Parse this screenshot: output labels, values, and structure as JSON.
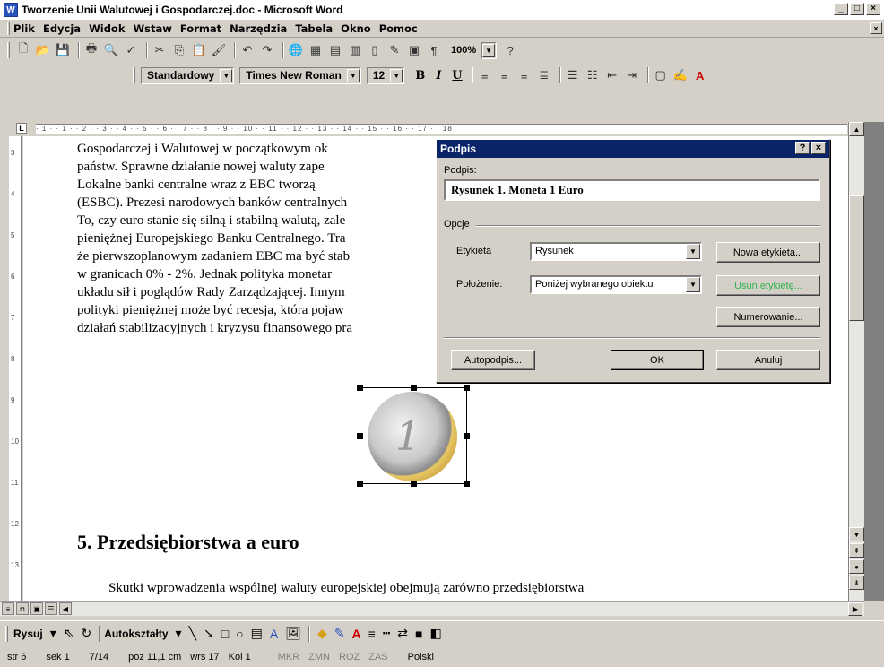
{
  "window": {
    "title": "Tworzenie Unii Walutowej i Gospodarczej.doc - Microsoft Word",
    "app_icon": "W",
    "controls": [
      "_",
      "□",
      "×"
    ]
  },
  "menu": [
    "Plik",
    "Edycja",
    "Widok",
    "Wstaw",
    "Format",
    "Narzędzia",
    "Tabela",
    "Okno",
    "Pomoc"
  ],
  "toolbar": {
    "zoom": "100%",
    "style": "Standardowy",
    "font": "Times New Roman",
    "size": "12",
    "bold": "B",
    "italic": "I",
    "underline": "U",
    "pilcrow": "¶"
  },
  "ruler": {
    "h_ticks": "· 1 · · 1 · · 2 · · 3 · · 4 · · 5 · · 6 · · 7 · · 8 · · 9 · · 10 · · 11 · · 12 · · 13 · · 14 · · 15 · · 16 · · 17 · · 18",
    "v_ticks": [
      "3",
      "4",
      "5",
      "6",
      "7",
      "8",
      "9",
      "10",
      "11",
      "12",
      "13"
    ],
    "tab_selector": "L"
  },
  "document": {
    "lines": [
      "Gospodarczej i Walutowej w początkowym ok",
      "państw. Sprawne działanie nowej waluty zape",
      "Lokalne banki centralne wraz z EBC tworzą",
      "(ESBC). Prezesi narodowych banków centralnych",
      "To, czy euro stanie się silną i stabilną walutą, zale",
      "pieniężnej Europejskiego Banku Centralnego. Tra",
      "że pierwszoplanowym zadaniem EBC ma być stab",
      "w granicach 0% - 2%. Jednak polityka monetar",
      "układu sił i poglądów Rady Zarządzającej. Innym",
      "polityki pieniężnej może być recesja, która pojaw",
      "działań stabilizacyjnych i kryzysu finansowego pra"
    ],
    "heading": "5.  Przedsiębiorstwa a euro",
    "paragraph": "Skutki wprowadzenia wspólnej waluty europejskiej obejmują zarówno przedsiębiorstwa",
    "image_icon": "euro-coin-icon"
  },
  "dialog": {
    "title": "Podpis",
    "help": "?",
    "close": "×",
    "caption_label": "Podpis:",
    "caption_value": "Rysunek 1. Moneta 1 Euro",
    "options_label": "Opcje",
    "label_label": "Etykieta",
    "label_value": "Rysunek",
    "position_label": "Położenie:",
    "position_value": "Poniżej wybranego obiektu",
    "new_label_button": "Nowa etykieta...",
    "delete_label_button": "Usuń etykietę...",
    "numbering_button": "Numerowanie...",
    "autocaption_button": "Autopodpis...",
    "ok_button": "OK",
    "cancel_button": "Anuluj"
  },
  "drawing_toolbar": {
    "draw": "Rysuj",
    "autoshapes": "Autokształty"
  },
  "status": {
    "page": "str 6",
    "section": "sek 1",
    "pages": "7/14",
    "position": "poz 11,1 cm",
    "line": "wrs 17",
    "column": "Kol 1",
    "rec": "MKR",
    "trk": "ZMN",
    "ext": "ROZ",
    "ovr": "ZAS",
    "language": "Polski"
  },
  "colors": {
    "dialog_title": "#0a246a",
    "disabled_button_text": "#2db34a",
    "chrome": "#d4d0c8"
  }
}
